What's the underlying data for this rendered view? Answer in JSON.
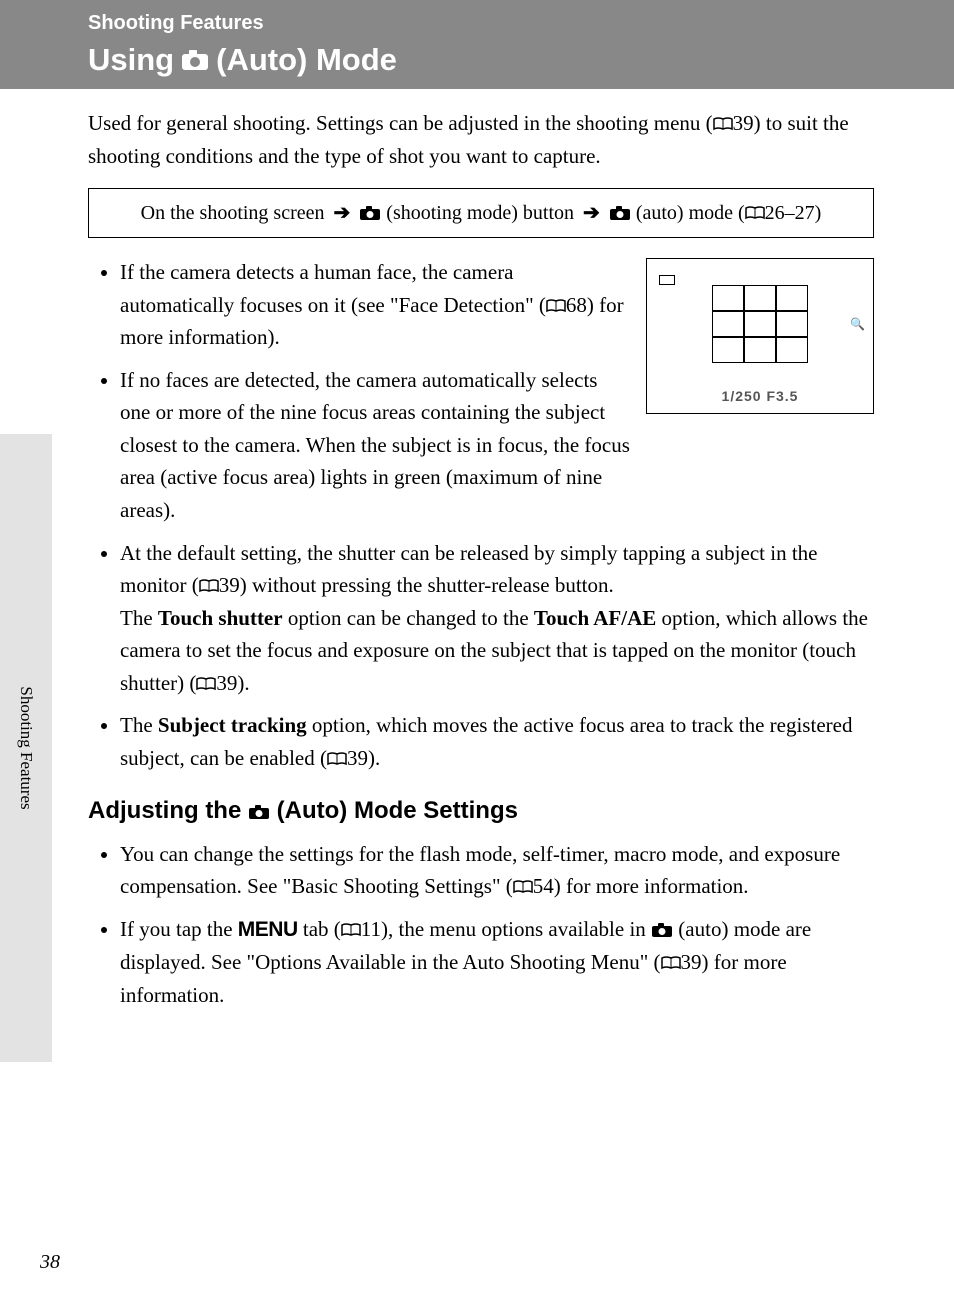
{
  "section_head": "Shooting Features",
  "title_prefix": "Using ",
  "title_suffix": " (Auto) Mode",
  "intro_part1": "Used for general shooting. Settings can be adjusted in the shooting menu (",
  "intro_ref1": "39) to suit the shooting conditions and the type of shot you want to capture.",
  "navbox": {
    "part1": "On the shooting screen ",
    "part2": " (shooting mode) button ",
    "part3": " (auto) mode (",
    "ref": "26–27)"
  },
  "bullets1": {
    "b1a": "If the camera detects a human face, the camera automatically focuses on it (see \"Face Detection\" (",
    "b1ref": "68) for more information).",
    "b2": "If no faces are detected, the camera automatically selects one or more of the nine focus areas containing the subject closest to the camera. When the subject is in focus, the focus area (active focus area) lights in green (maximum of nine areas)."
  },
  "bullets2": {
    "b3a": "At the default setting, the shutter can be released by simply tapping a subject in the monitor (",
    "b3ref1": "39) without pressing the shutter-release button.",
    "b3b": "The ",
    "b3bold1": "Touch shutter",
    "b3c": " option can be changed to the ",
    "b3bold2": "Touch AF/AE",
    "b3d": " option, which allows the camera to set the focus and exposure on the subject that is tapped on the monitor (touch shutter) (",
    "b3ref2": "39).",
    "b4a": "The ",
    "b4bold": "Subject tracking",
    "b4b": " option, which moves the active focus area to track the registered subject, can be enabled (",
    "b4ref": "39)."
  },
  "subheading_pre": "Adjusting the ",
  "subheading_post": " (Auto) Mode Settings",
  "bullets3": {
    "b5a": "You can change the settings for the flash mode, self-timer, macro mode, and exposure compensation. See \"Basic Shooting Settings\" (",
    "b5ref": "54) for more information.",
    "b6a": "If you tap the ",
    "b6menu": "MENU",
    "b6b": " tab (",
    "b6ref1": "11), the menu options available in ",
    "b6c": " (auto) mode are displayed. See \"Options Available in the Auto Shooting Menu\" (",
    "b6ref2": "39) for more information."
  },
  "viewfinder_text": "1/250  F3.5",
  "sidetab": "Shooting Features",
  "page_number": "38"
}
